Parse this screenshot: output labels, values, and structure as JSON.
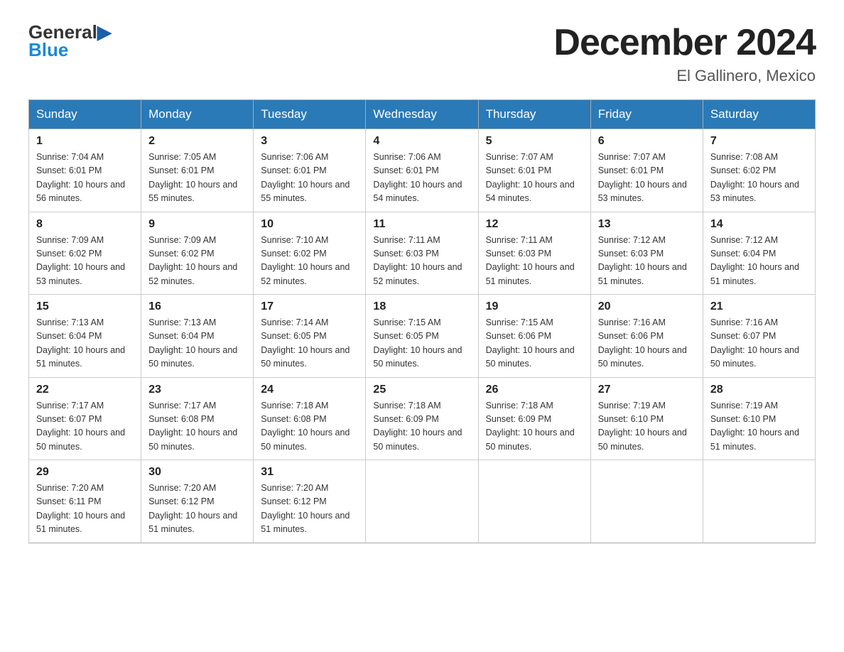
{
  "logo": {
    "general": "General",
    "blue": "Blue",
    "triangle": "▶"
  },
  "title": "December 2024",
  "location": "El Gallinero, Mexico",
  "days_of_week": [
    "Sunday",
    "Monday",
    "Tuesday",
    "Wednesday",
    "Thursday",
    "Friday",
    "Saturday"
  ],
  "weeks": [
    [
      {
        "day": 1,
        "sunrise": "7:04 AM",
        "sunset": "6:01 PM",
        "daylight": "10 hours and 56 minutes"
      },
      {
        "day": 2,
        "sunrise": "7:05 AM",
        "sunset": "6:01 PM",
        "daylight": "10 hours and 55 minutes"
      },
      {
        "day": 3,
        "sunrise": "7:06 AM",
        "sunset": "6:01 PM",
        "daylight": "10 hours and 55 minutes"
      },
      {
        "day": 4,
        "sunrise": "7:06 AM",
        "sunset": "6:01 PM",
        "daylight": "10 hours and 54 minutes"
      },
      {
        "day": 5,
        "sunrise": "7:07 AM",
        "sunset": "6:01 PM",
        "daylight": "10 hours and 54 minutes"
      },
      {
        "day": 6,
        "sunrise": "7:07 AM",
        "sunset": "6:01 PM",
        "daylight": "10 hours and 53 minutes"
      },
      {
        "day": 7,
        "sunrise": "7:08 AM",
        "sunset": "6:02 PM",
        "daylight": "10 hours and 53 minutes"
      }
    ],
    [
      {
        "day": 8,
        "sunrise": "7:09 AM",
        "sunset": "6:02 PM",
        "daylight": "10 hours and 53 minutes"
      },
      {
        "day": 9,
        "sunrise": "7:09 AM",
        "sunset": "6:02 PM",
        "daylight": "10 hours and 52 minutes"
      },
      {
        "day": 10,
        "sunrise": "7:10 AM",
        "sunset": "6:02 PM",
        "daylight": "10 hours and 52 minutes"
      },
      {
        "day": 11,
        "sunrise": "7:11 AM",
        "sunset": "6:03 PM",
        "daylight": "10 hours and 52 minutes"
      },
      {
        "day": 12,
        "sunrise": "7:11 AM",
        "sunset": "6:03 PM",
        "daylight": "10 hours and 51 minutes"
      },
      {
        "day": 13,
        "sunrise": "7:12 AM",
        "sunset": "6:03 PM",
        "daylight": "10 hours and 51 minutes"
      },
      {
        "day": 14,
        "sunrise": "7:12 AM",
        "sunset": "6:04 PM",
        "daylight": "10 hours and 51 minutes"
      }
    ],
    [
      {
        "day": 15,
        "sunrise": "7:13 AM",
        "sunset": "6:04 PM",
        "daylight": "10 hours and 51 minutes"
      },
      {
        "day": 16,
        "sunrise": "7:13 AM",
        "sunset": "6:04 PM",
        "daylight": "10 hours and 50 minutes"
      },
      {
        "day": 17,
        "sunrise": "7:14 AM",
        "sunset": "6:05 PM",
        "daylight": "10 hours and 50 minutes"
      },
      {
        "day": 18,
        "sunrise": "7:15 AM",
        "sunset": "6:05 PM",
        "daylight": "10 hours and 50 minutes"
      },
      {
        "day": 19,
        "sunrise": "7:15 AM",
        "sunset": "6:06 PM",
        "daylight": "10 hours and 50 minutes"
      },
      {
        "day": 20,
        "sunrise": "7:16 AM",
        "sunset": "6:06 PM",
        "daylight": "10 hours and 50 minutes"
      },
      {
        "day": 21,
        "sunrise": "7:16 AM",
        "sunset": "6:07 PM",
        "daylight": "10 hours and 50 minutes"
      }
    ],
    [
      {
        "day": 22,
        "sunrise": "7:17 AM",
        "sunset": "6:07 PM",
        "daylight": "10 hours and 50 minutes"
      },
      {
        "day": 23,
        "sunrise": "7:17 AM",
        "sunset": "6:08 PM",
        "daylight": "10 hours and 50 minutes"
      },
      {
        "day": 24,
        "sunrise": "7:18 AM",
        "sunset": "6:08 PM",
        "daylight": "10 hours and 50 minutes"
      },
      {
        "day": 25,
        "sunrise": "7:18 AM",
        "sunset": "6:09 PM",
        "daylight": "10 hours and 50 minutes"
      },
      {
        "day": 26,
        "sunrise": "7:18 AM",
        "sunset": "6:09 PM",
        "daylight": "10 hours and 50 minutes"
      },
      {
        "day": 27,
        "sunrise": "7:19 AM",
        "sunset": "6:10 PM",
        "daylight": "10 hours and 50 minutes"
      },
      {
        "day": 28,
        "sunrise": "7:19 AM",
        "sunset": "6:10 PM",
        "daylight": "10 hours and 51 minutes"
      }
    ],
    [
      {
        "day": 29,
        "sunrise": "7:20 AM",
        "sunset": "6:11 PM",
        "daylight": "10 hours and 51 minutes"
      },
      {
        "day": 30,
        "sunrise": "7:20 AM",
        "sunset": "6:12 PM",
        "daylight": "10 hours and 51 minutes"
      },
      {
        "day": 31,
        "sunrise": "7:20 AM",
        "sunset": "6:12 PM",
        "daylight": "10 hours and 51 minutes"
      },
      null,
      null,
      null,
      null
    ]
  ]
}
